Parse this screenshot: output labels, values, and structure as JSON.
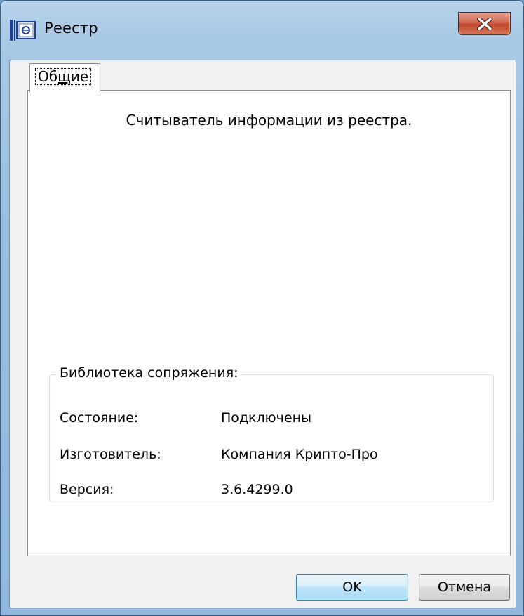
{
  "window": {
    "title": "Реестр",
    "close_label": "x"
  },
  "tabs": [
    {
      "label_before": "Об",
      "label_underlined": "щ",
      "label_after": "ие",
      "selected": true
    }
  ],
  "panel": {
    "description": "Считыватель информации из реестра.",
    "group": {
      "legend": "Библиотека сопряжения:",
      "rows": [
        {
          "label": "Состояние:",
          "value": "Подключены"
        },
        {
          "label": "Изготовитель:",
          "value": "Компания Крипто-Про"
        },
        {
          "label": "Версия:",
          "value": "3.6.4299.0"
        }
      ]
    }
  },
  "buttons": {
    "ok_label": "OK",
    "cancel_label": "Отмена"
  },
  "colors": {
    "frame": "#98bde0",
    "close_button": "#c1482d",
    "client_bg": "#f0f0f0",
    "ok_border": "#3c7fb1"
  }
}
